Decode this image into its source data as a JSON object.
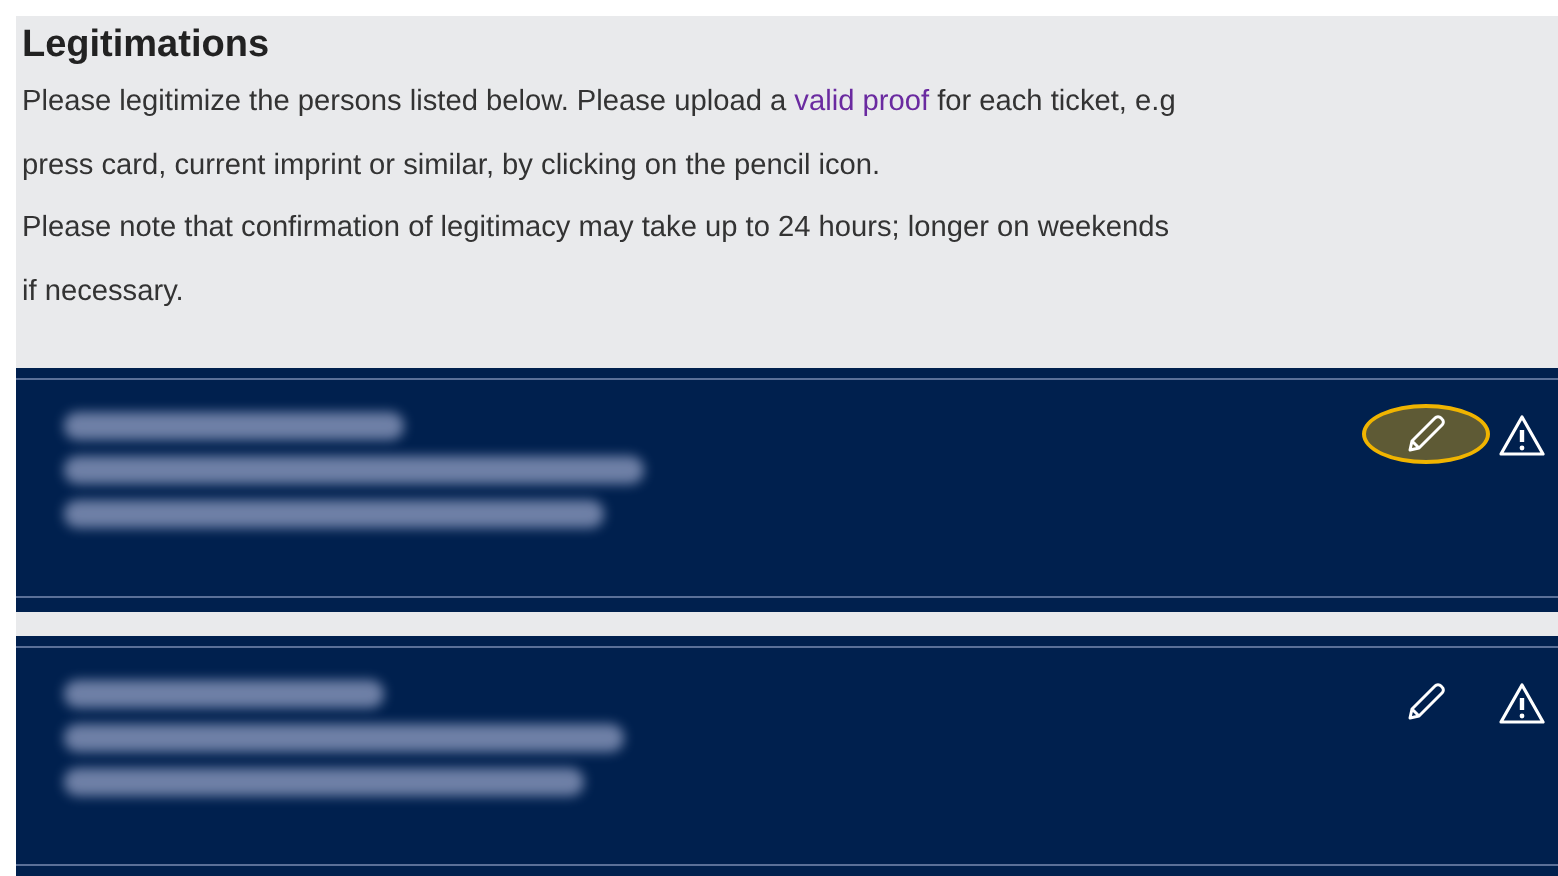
{
  "section": {
    "title": "Legitimations",
    "intro": [
      {
        "before": "Please legitimize the persons listed below. Please upload a ",
        "link": "valid proof",
        "after": " for each ticket, e.g"
      },
      {
        "before": "press card, current imprint or similar, by clicking on the pencil icon."
      },
      {
        "before": "Please note that confirmation of legitimacy may take up to 24 hours; longer on weekends"
      },
      {
        "before": "if necessary."
      }
    ]
  },
  "persons": [
    {
      "edit_focused": true
    },
    {
      "edit_focused": false
    }
  ]
}
